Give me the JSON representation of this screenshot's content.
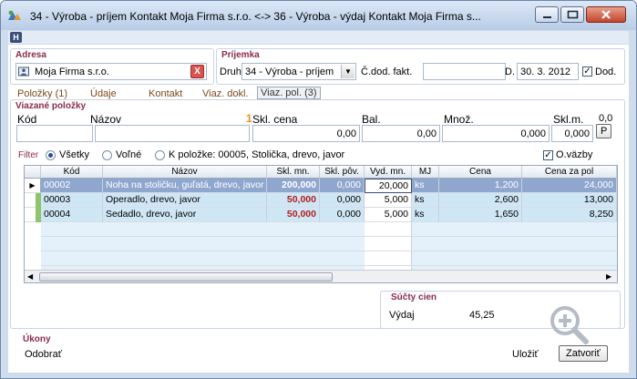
{
  "window": {
    "title": "34 - Výroba - príjem   Kontakt Moja Firma s.r.o.  <-> 36 - Výroba - výdaj   Kontakt Moja Firma s..."
  },
  "toolbar": {
    "h_label": "H"
  },
  "adresa": {
    "section_label": "Adresa",
    "value": "Moja Firma s.r.o.",
    "clear_label": "X"
  },
  "prijemka": {
    "section_label": "Príjemka",
    "druh_label": "Druh",
    "druh_value": "34 - Výroba - príjem",
    "cdod_label": "Č.dod. fakt.",
    "cdod_value": "",
    "d_label": "D.",
    "date_value": "30. 3. 2012",
    "dod_label": "Dod.",
    "dod_checked": true
  },
  "tabs": [
    {
      "label": "Položky (1)",
      "active": false
    },
    {
      "label": "Údaje",
      "active": false
    },
    {
      "label": "Kontakt",
      "active": false
    },
    {
      "label": "Viaz. dokl.",
      "active": false
    },
    {
      "label": "Viaz. pol. (3)",
      "active": true
    }
  ],
  "viazane": {
    "section_label": "Viazané položky",
    "kod_label": "Kód",
    "nazov_label": "Názov",
    "skl_cena_label": "Skl. cena",
    "skl_cena_marker": "1",
    "bal_label": "Bal.",
    "mnoz_label": "Množ.",
    "sklm_label": "Skl.m.",
    "sklm_value": "0,0",
    "kod_value": "",
    "nazov_value": "",
    "skl_cena_value": "0,00",
    "bal_value": "0,00",
    "mnoz_value": "0,000",
    "sklm_field_value": "0,000",
    "p_button": "P"
  },
  "filter": {
    "label": "Filter",
    "options": [
      "Všetky",
      "Voľné",
      "K položke: 00005, Stolička, drevo, javor"
    ],
    "selected": "Všetky",
    "ovazby_label": "O.väzby",
    "ovazby_checked": true
  },
  "grid": {
    "columns": [
      "Kód",
      "Názov",
      "Skl. mn.",
      "Skl. pôv.",
      "Vyd. mn.",
      "MJ",
      "Cena",
      "Cena za pol"
    ],
    "rows": [
      {
        "kod": "00002",
        "nazov": "Noha na stoličku, guľatá, drevo, javor",
        "skl_mn": "200,000",
        "skl_pov": "0,000",
        "vyd_mn": "20,000",
        "mj": "ks",
        "cena": "1,200",
        "cena_za_pol": "24,000"
      },
      {
        "kod": "00003",
        "nazov": "Operadlo, drevo, javor",
        "skl_mn": "50,000",
        "skl_pov": "0,000",
        "vyd_mn": "5,000",
        "mj": "ks",
        "cena": "2,600",
        "cena_za_pol": "13,000"
      },
      {
        "kod": "00004",
        "nazov": "Sedadlo, drevo, javor",
        "skl_mn": "50,000",
        "skl_pov": "0,000",
        "vyd_mn": "5,000",
        "mj": "ks",
        "cena": "1,650",
        "cena_za_pol": "8,250"
      }
    ]
  },
  "sucty": {
    "section_label": "Súčty cien",
    "vydaj_label": "Výdaj",
    "vydaj_value": "45,25"
  },
  "ukony": {
    "section_label": "Úkony",
    "odobrat_label": "Odobrať"
  },
  "buttons": {
    "ulozit": "Uložiť",
    "zatvorit": "Zatvoriť"
  },
  "colors": {
    "accent": "#8a2c4a",
    "row_highlight": "#cfe6f5",
    "row_selected": "#8fa7cf",
    "red_value": "#b22020"
  }
}
